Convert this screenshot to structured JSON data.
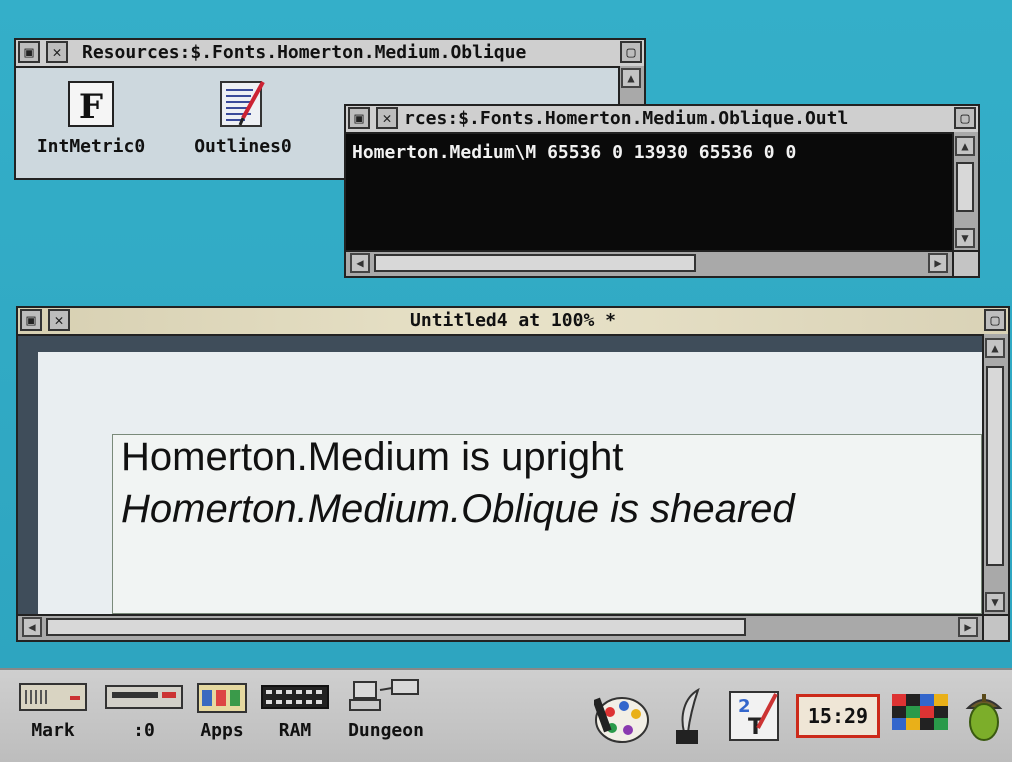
{
  "filer_window": {
    "title": "Resources:$.Fonts.Homerton.Medium.Oblique",
    "files": [
      {
        "name": "IntMetric0",
        "icon": "font-metrics-file-icon"
      },
      {
        "name": "Outlines0",
        "icon": "outline-font-file-icon"
      }
    ]
  },
  "outline_window": {
    "title": "rces:$.Fonts.Homerton.Medium.Oblique.Outl",
    "text": "Homerton.Medium\\M 65536 0 13930 65536 0 0"
  },
  "draw_window": {
    "title": "Untitled4 at 100% *",
    "line1": "Homerton.Medium is upright",
    "line2": "Homerton.Medium.Oblique is sheared"
  },
  "iconbar": {
    "items": [
      {
        "label": "Mark",
        "icon": "floppy-disc-drive-icon"
      },
      {
        "label": ":0",
        "icon": "hard-disc-drive-icon"
      },
      {
        "label": "Apps",
        "icon": "apps-folder-icon"
      },
      {
        "label": "RAM",
        "icon": "ram-disc-icon"
      },
      {
        "label": "Dungeon",
        "icon": "network-computers-icon"
      }
    ],
    "clock": "15:29",
    "right_icons": [
      "paint-palette-icon",
      "edit-quill-icon",
      "draw-icon",
      "clock-icon",
      "display-palette-icon",
      "acorn-icon"
    ]
  }
}
